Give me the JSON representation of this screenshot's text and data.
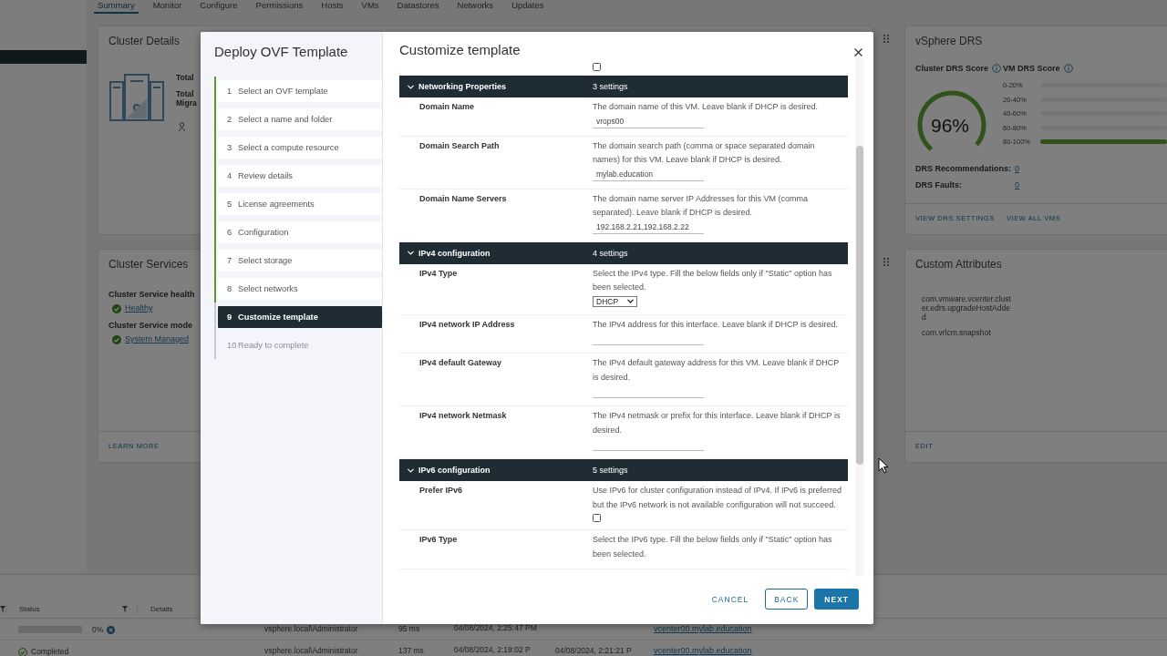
{
  "tabs": [
    {
      "label": "Summary",
      "selected": true
    },
    {
      "label": "Monitor",
      "selected": false
    },
    {
      "label": "Configure",
      "selected": false
    },
    {
      "label": "Permissions",
      "selected": false
    },
    {
      "label": "Hosts",
      "selected": false
    },
    {
      "label": "VMs",
      "selected": false
    },
    {
      "label": "Datastores",
      "selected": false
    },
    {
      "label": "Networks",
      "selected": false
    },
    {
      "label": "Updates",
      "selected": false
    }
  ],
  "cluster_details": {
    "title": "Cluster Details",
    "labels": [
      "Total",
      "Total",
      "Migra"
    ]
  },
  "cluster_services": {
    "title": "Cluster Services",
    "items": [
      {
        "heading": "Cluster Service health",
        "status": "Healthy"
      },
      {
        "heading": "Cluster Service mode",
        "status": "System Managed"
      }
    ],
    "footer_link": "LEARN MORE"
  },
  "drs": {
    "title": "vSphere DRS",
    "cluster_score_label": "Cluster DRS Score",
    "score": "96%",
    "vm_score_label": "VM DRS Score",
    "buckets": [
      {
        "label": "0-20%"
      },
      {
        "label": "20-40%"
      },
      {
        "label": "40-60%"
      },
      {
        "label": "60-80%"
      },
      {
        "label": "80-100%",
        "level": 1
      }
    ],
    "stats": [
      {
        "label": "DRS Recommendations:",
        "value": "0"
      },
      {
        "label": "DRS Faults:",
        "value": "0"
      }
    ],
    "links": [
      "VIEW DRS SETTINGS",
      "VIEW ALL VMS"
    ]
  },
  "custom_attributes": {
    "title": "Custom Attributes",
    "items": [
      "com.vmware.vcenter.cluster.edrs.upgradeHostAdded",
      "com.vrlcm.snapshot"
    ],
    "footer_link": "EDIT"
  },
  "tasks": {
    "columns": [
      {
        "label": "Status",
        "filter": true
      },
      {
        "label": "Details",
        "filter": false
      }
    ],
    "rows": [
      {
        "kind": "running",
        "status": "0%",
        "initiator": "vsphere.local\\Administrator",
        "queued": "95 ms",
        "start": "04/08/2024, 2:25:47 PM",
        "server": "vcenter00.mylab.education"
      },
      {
        "kind": "completed",
        "status": "Completed",
        "initiator": "vsphere.local\\Administrator",
        "queued": "137 ms",
        "start": "04/08/2024, 2:19:02 P",
        "completion": "04/08/2024, 2:21:21 P",
        "server": "vcenter00.mylab.education"
      }
    ]
  },
  "wizard": {
    "title": "Deploy OVF Template",
    "steps": [
      {
        "number": "1",
        "label": "Select an OVF template",
        "done": true,
        "selected": false,
        "disabled": false
      },
      {
        "number": "2",
        "label": "Select a name and folder",
        "done": true,
        "selected": false,
        "disabled": false
      },
      {
        "number": "3",
        "label": "Select a compute resource",
        "done": true,
        "selected": false,
        "disabled": false
      },
      {
        "number": "4",
        "label": "Review details",
        "done": true,
        "selected": false,
        "disabled": false
      },
      {
        "number": "5",
        "label": "License agreements",
        "done": true,
        "selected": false,
        "disabled": false
      },
      {
        "number": "6",
        "label": "Configuration",
        "done": true,
        "selected": false,
        "disabled": false
      },
      {
        "number": "7",
        "label": "Select storage",
        "done": true,
        "selected": false,
        "disabled": false
      },
      {
        "number": "8",
        "label": "Select networks",
        "done": true,
        "selected": false,
        "disabled": false
      },
      {
        "number": "9",
        "label": "Customize template",
        "done": false,
        "selected": true,
        "disabled": false
      },
      {
        "number": "10",
        "label": "Ready to complete",
        "done": false,
        "selected": false,
        "disabled": true
      }
    ],
    "page_title": "Customize template",
    "leading_control": {
      "kind": "checkbox",
      "checked": false
    },
    "sections": [
      {
        "title": "Networking Properties",
        "count": "3 settings",
        "expanded": true,
        "fields": [
          {
            "label": "Domain Name",
            "description": "The domain name of this VM. Leave blank if DHCP is desired.",
            "kind": "text",
            "value": "vrops00"
          },
          {
            "label": "Domain Search Path",
            "description": "The domain search path (comma or space separated domain names) for this VM. Leave blank if DHCP is desired.",
            "kind": "text",
            "value": "mylab.education"
          },
          {
            "label": "Domain Name Servers",
            "description": "The domain name server IP Addresses for this VM (comma separated). Leave blank if DHCP is desired.",
            "kind": "text",
            "value": "192.168.2.21,192.168.2.22"
          }
        ]
      },
      {
        "title": "IPv4 configuration",
        "count": "4 settings",
        "expanded": true,
        "fields": [
          {
            "label": "IPv4 Type",
            "description": "Select the IPv4 type. Fill the below fields only if \"Static\" option has been selected.",
            "kind": "select",
            "value": "DHCP"
          },
          {
            "label": "IPv4 network IP Address",
            "description": "The IPv4 address for this interface. Leave blank if DHCP is desired.",
            "kind": "text"
          },
          {
            "label": "IPv4 default Gateway",
            "description": "The IPv4 default gateway address for this VM. Leave blank if DHCP is desired.",
            "kind": "text"
          },
          {
            "label": "IPv4 network Netmask",
            "description": "The IPv4 netmask or prefix for this interface. Leave blank if DHCP is desired.",
            "kind": "text"
          }
        ]
      },
      {
        "title": "IPv6 configuration",
        "count": "5 settings",
        "expanded": true,
        "fields": [
          {
            "label": "Prefer IPv6",
            "description": "Use IPv6 for cluster configuration instead of IPv4. If IPv6 is preferred but the IPv6 network is not available configuration will not succeed.",
            "kind": "checkbox",
            "checked": false
          },
          {
            "label": "IPv6 Type",
            "description": "Select the IPv6 type. Fill the below fields only if \"Static\" option has been selected.",
            "kind": "none"
          }
        ]
      }
    ],
    "buttons": [
      {
        "label": "CANCEL",
        "kind": "flat"
      },
      {
        "label": "BACK",
        "kind": "outline"
      },
      {
        "label": "NEXT",
        "kind": "primary"
      }
    ]
  }
}
